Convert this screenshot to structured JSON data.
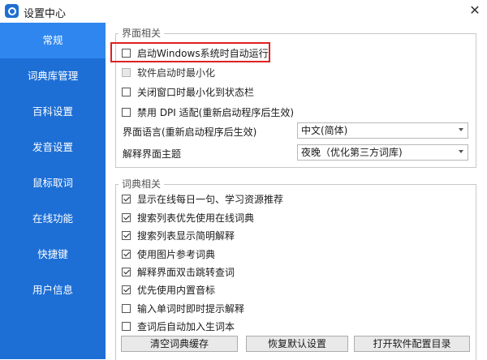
{
  "window": {
    "title": "设置中心",
    "close_label": "✕"
  },
  "sidebar": {
    "items": [
      {
        "label": "常规"
      },
      {
        "label": "词典库管理"
      },
      {
        "label": "百科设置"
      },
      {
        "label": "发音设置"
      },
      {
        "label": "鼠标取词"
      },
      {
        "label": "在线功能"
      },
      {
        "label": "快捷键"
      },
      {
        "label": "用户信息"
      }
    ],
    "active_index": 0
  },
  "interface_group": {
    "title": "界面相关",
    "options": [
      {
        "label": "启动Windows系统时自动运行",
        "checked": false,
        "disabled": false
      },
      {
        "label": "软件启动时最小化",
        "checked": false,
        "disabled": true
      },
      {
        "label": "关闭窗口时最小化到状态栏",
        "checked": false,
        "disabled": false
      },
      {
        "label": "禁用 DPI 适配(重新启动程序后生效)",
        "checked": false,
        "disabled": false
      }
    ],
    "language": {
      "label": "界面语言(重新启动程序后生效)",
      "value": "中文(简体)"
    },
    "theme": {
      "label": "解释界面主题",
      "value": "夜晚（优化第三方词库)"
    }
  },
  "dict_group": {
    "title": "词典相关",
    "options": [
      {
        "label": "显示在线每日一句、学习资源推荐",
        "checked": true
      },
      {
        "label": "搜索列表优先使用在线词典",
        "checked": true
      },
      {
        "label": "搜索列表显示简明解释",
        "checked": true
      },
      {
        "label": "使用图片参考词典",
        "checked": true
      },
      {
        "label": "解释界面双击跳转查词",
        "checked": true
      },
      {
        "label": "优先使用内置音标",
        "checked": true
      },
      {
        "label": "输入单词时即时提示解释",
        "checked": false
      },
      {
        "label": "查词后自动加入生词本",
        "checked": false
      }
    ]
  },
  "buttons": {
    "clear_cache": "清空词典缓存",
    "restore_defaults": "恢复默认设置",
    "open_config": "打开软件配置目录"
  },
  "colors": {
    "sidebar": "#1d6fd6",
    "sidebar_active": "#2f86ee",
    "highlight": "#e02020"
  }
}
